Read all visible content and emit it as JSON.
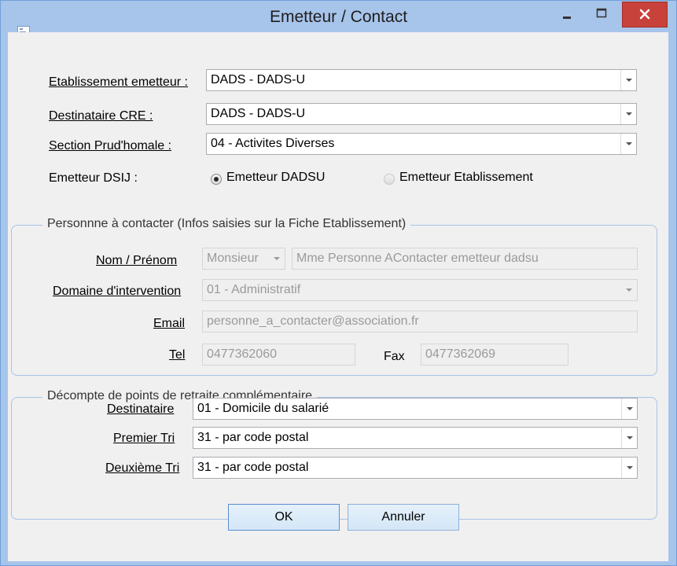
{
  "window": {
    "title": "Emetteur / Contact",
    "accent_color": "#a7c4ea",
    "close_color": "#c7423b",
    "icons": {
      "app": "app-icon",
      "minimize": "minimize-icon",
      "maximize": "maximize-icon",
      "close": "close-icon"
    }
  },
  "form": {
    "etablissement_label": "Etablissement emetteur :",
    "etablissement_value": "DADS - DADS-U",
    "destinataire_cre_label": "Destinataire CRE :",
    "destinataire_cre_value": "DADS - DADS-U",
    "section_label": "Section Prud'homale :",
    "section_value": "04 - Activites Diverses",
    "emetteur_dsij_label": "Emetteur DSIJ :",
    "radio_dadsu_label": "Emetteur DADSU",
    "radio_dadsu_selected": true,
    "radio_etab_label": "Emetteur Etablissement",
    "radio_etab_selected": false
  },
  "contact": {
    "group_title": "Personnne à contacter (Infos saisies sur la Fiche Etablissement)",
    "nom_label": "Nom / Prénom",
    "civility_value": "Monsieur",
    "name_value": "Mme Personne AContacter  emetteur dadsu",
    "domaine_label": "Domaine d'intervention",
    "domaine_value": "01 - Administratif",
    "email_label": "Email",
    "email_value": "personne_a_contacter@association.fr",
    "tel_label": "Tel",
    "tel_value": "0477362060",
    "fax_label": "Fax",
    "fax_value": "0477362069"
  },
  "retraite": {
    "group_title": "Décompte de points de retraite complémentaire",
    "destinataire_label": "Destinataire",
    "destinataire_value": "01 - Domicile du salarié",
    "premier_label": "Premier Tri",
    "premier_value": "31 - par code postal",
    "deuxieme_label": "Deuxième Tri",
    "deuxieme_value": "31 - par code postal"
  },
  "buttons": {
    "ok_label": "OK",
    "cancel_label": "Annuler"
  }
}
